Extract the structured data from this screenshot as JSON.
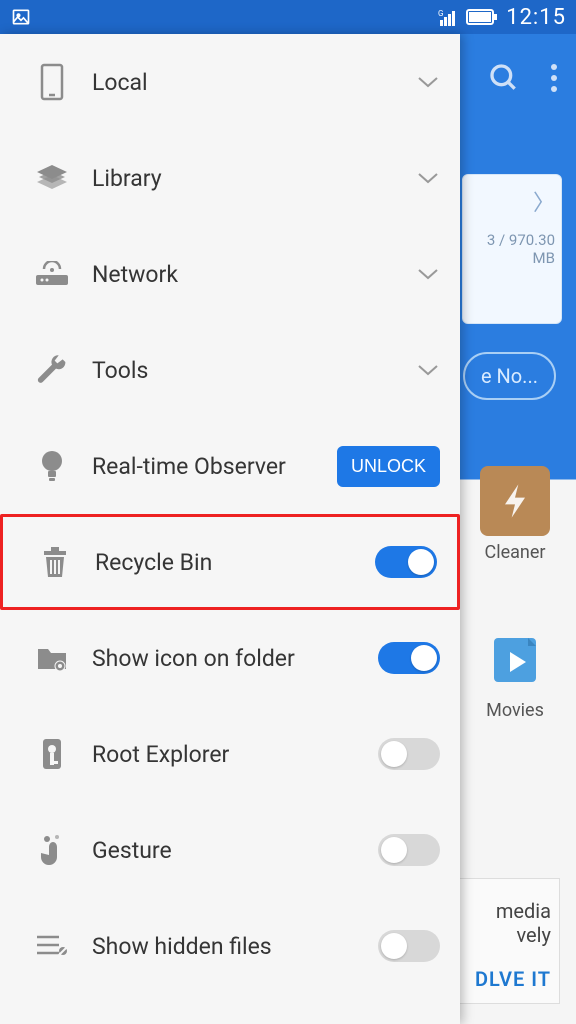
{
  "status": {
    "time": "12:15"
  },
  "background": {
    "storage": "3 / 970.30 MB",
    "button": "e No...",
    "tiles": {
      "cleaner": "Cleaner",
      "movies": "Movies"
    },
    "bottom": {
      "line1": "media",
      "line2": "vely",
      "solve": "DLVE IT"
    }
  },
  "drawer": {
    "items": [
      {
        "label": "Local",
        "type": "expand"
      },
      {
        "label": "Library",
        "type": "expand"
      },
      {
        "label": "Network",
        "type": "expand"
      },
      {
        "label": "Tools",
        "type": "expand"
      },
      {
        "label": "Real-time Observer",
        "type": "unlock",
        "unlock_label": "UNLOCK"
      },
      {
        "label": "Recycle Bin",
        "type": "toggle",
        "on": true,
        "highlight": true
      },
      {
        "label": "Show icon on folder",
        "type": "toggle",
        "on": true
      },
      {
        "label": "Root Explorer",
        "type": "toggle",
        "on": false
      },
      {
        "label": "Gesture",
        "type": "toggle",
        "on": false
      },
      {
        "label": "Show hidden files",
        "type": "toggle",
        "on": false
      }
    ]
  }
}
